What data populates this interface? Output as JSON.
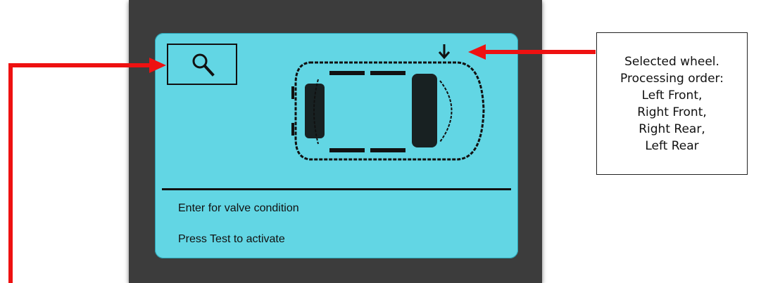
{
  "screen": {
    "search_icon": "magnifier-icon",
    "wheel_icon": "down-arrow-icon",
    "vehicle_icon": "car-top-view-icon",
    "line1": "Enter for valve condition",
    "line2": "Press Test to activate"
  },
  "callout": {
    "lines": [
      "Selected wheel.",
      "Processing order:",
      "Left Front,",
      "Right Front,",
      "Right Rear,",
      "Left Rear"
    ]
  },
  "colors": {
    "screen": "#62d6e4",
    "bezel": "#3c3c3c",
    "pointer": "#ee1111"
  }
}
